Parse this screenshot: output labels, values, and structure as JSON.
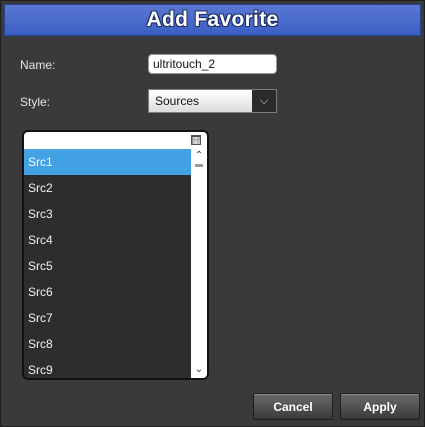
{
  "dialog": {
    "title": "Add Favorite"
  },
  "form": {
    "name_label": "Name:",
    "name_value": "ultritouch_2",
    "style_label": "Style:",
    "style_value": "Sources"
  },
  "list": {
    "items": [
      "Src1",
      "Src2",
      "Src3",
      "Src4",
      "Src5",
      "Src6",
      "Src7",
      "Src8",
      "Src9"
    ],
    "selected_index": 0
  },
  "buttons": {
    "cancel": "Cancel",
    "apply": "Apply"
  },
  "colors": {
    "title_bar": "#4a6cc9",
    "selected_row": "#43a2e4",
    "background": "#3a3a3a"
  }
}
